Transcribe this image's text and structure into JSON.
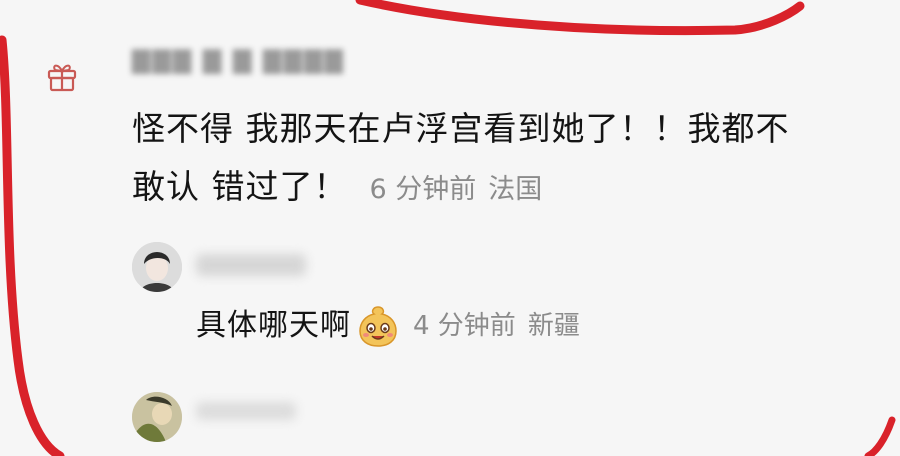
{
  "comment": {
    "text_line1": "怪不得 我那天在卢浮宫看到她了！！我都不",
    "text_line2": "敢认 错过了！",
    "time": "6 分钟前",
    "location": "法国"
  },
  "reply": {
    "text": "具体哪天啊",
    "time": "4 分钟前",
    "location": "新疆"
  },
  "icons": {
    "gift": "gift-icon",
    "emoji": "drooling-face-emoji"
  },
  "colors": {
    "annotation_red": "#d9222a",
    "text": "#141414",
    "meta": "#8b8b8b",
    "gift": "#c95a55"
  }
}
